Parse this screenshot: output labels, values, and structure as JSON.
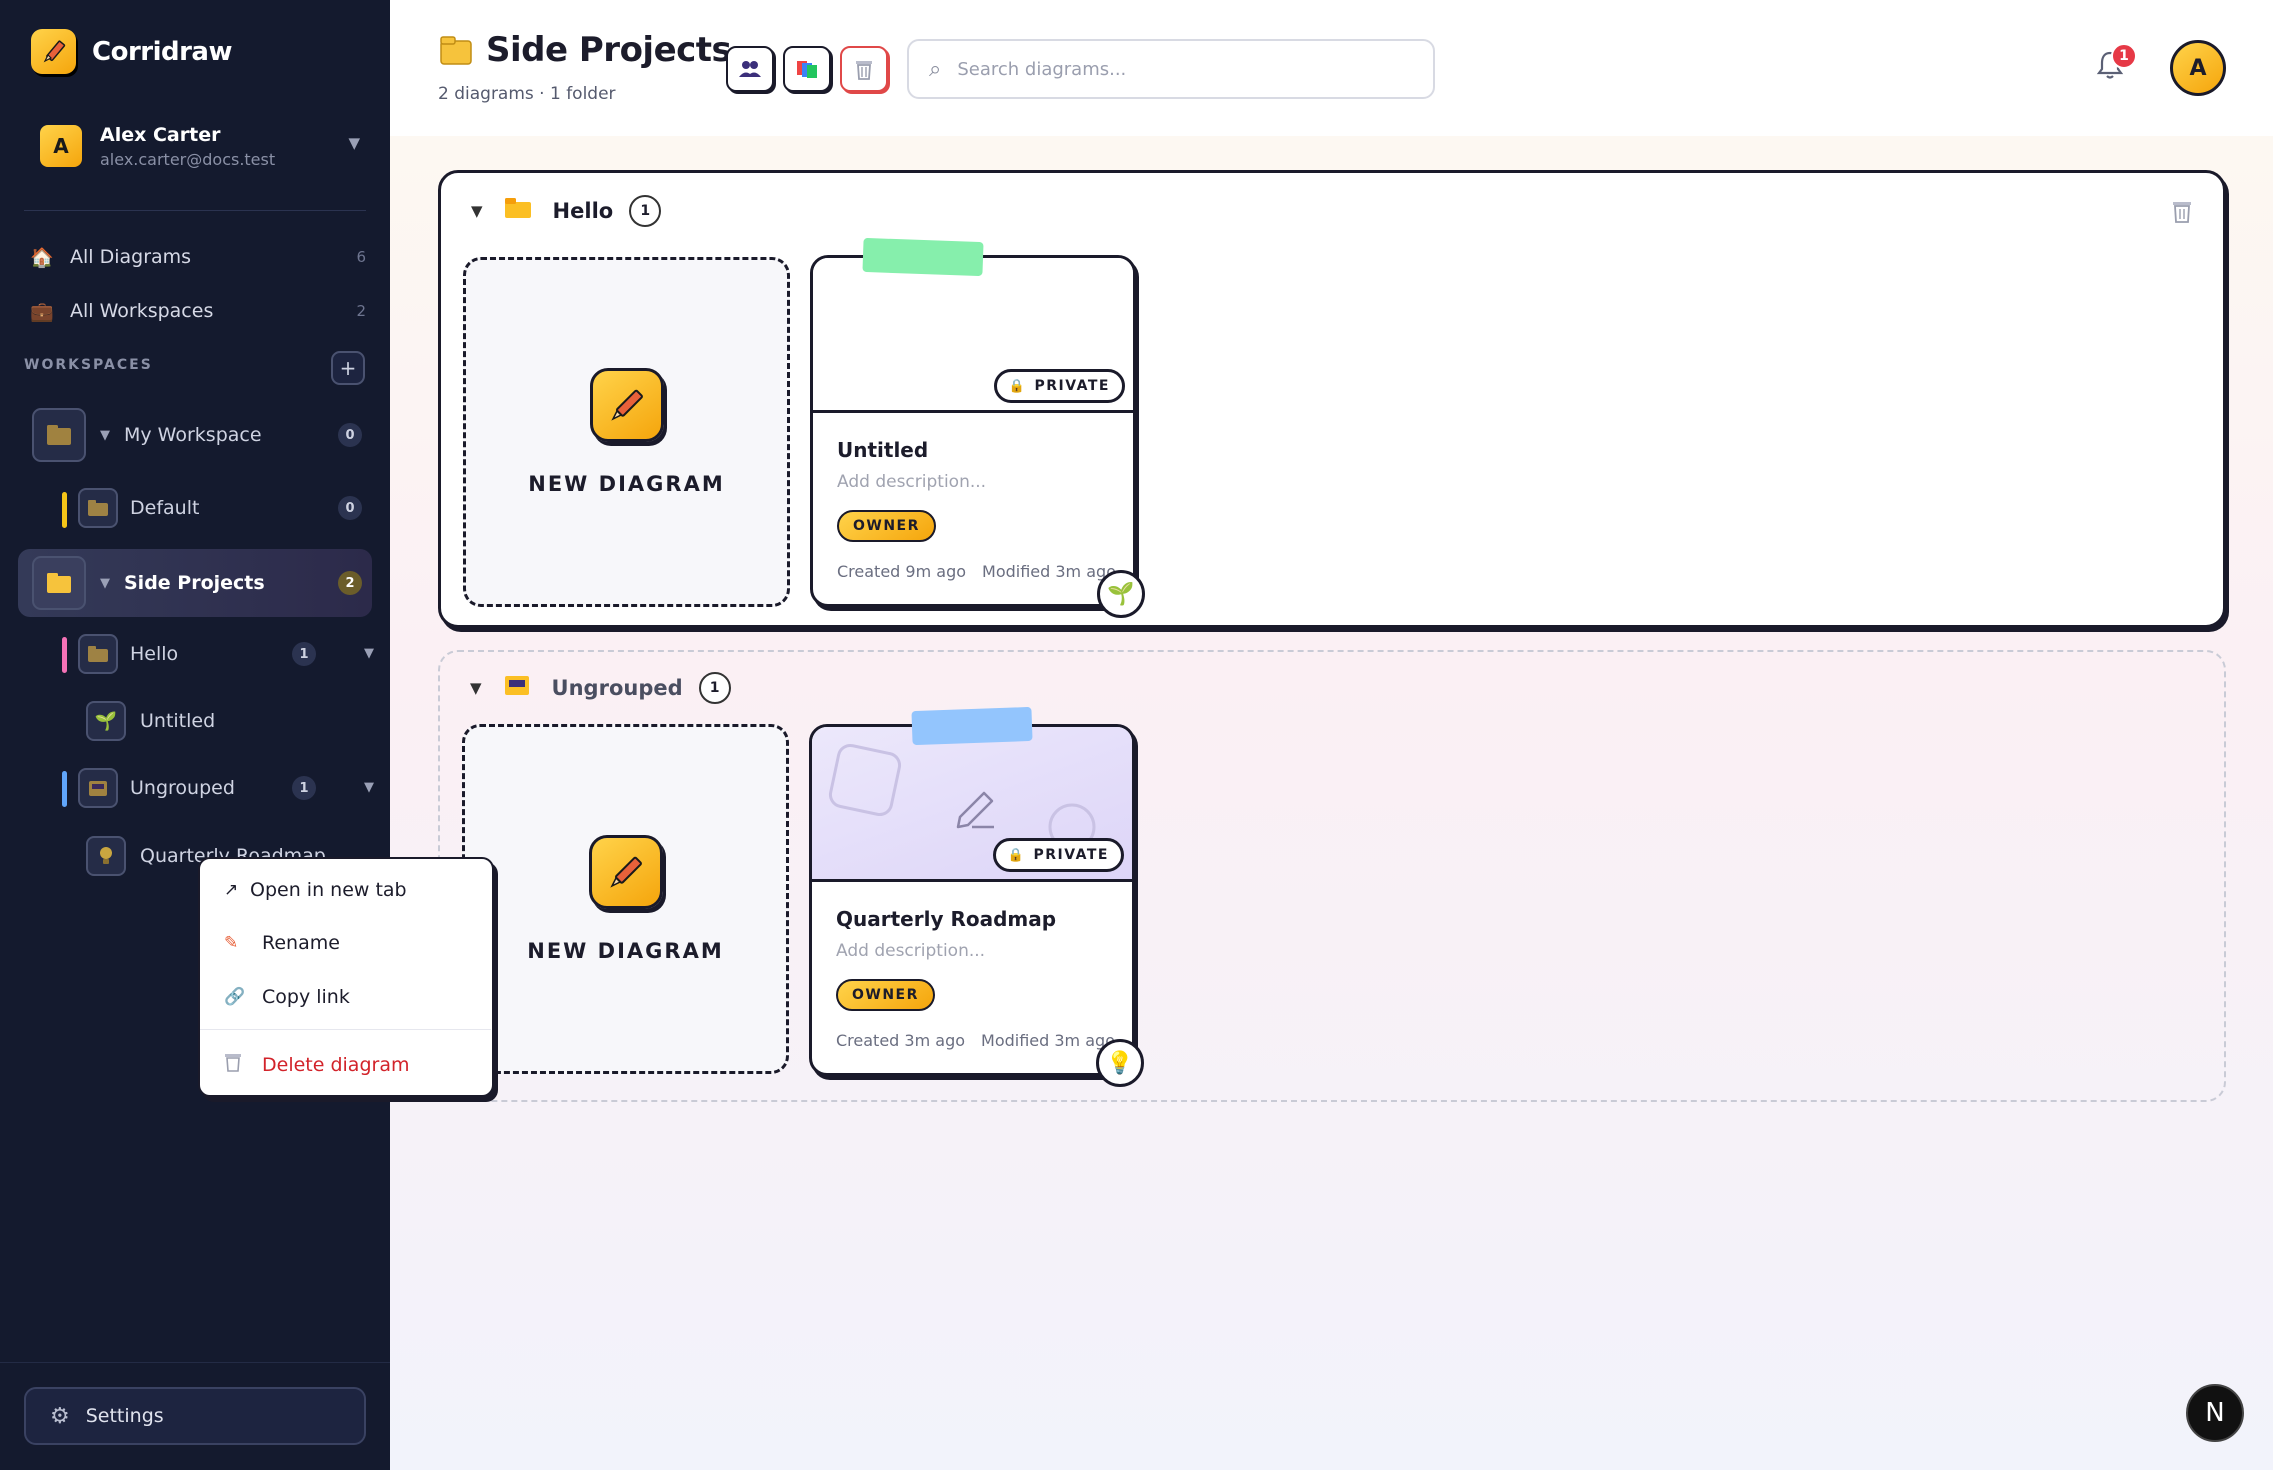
{
  "app": {
    "name": "Corridraw"
  },
  "user": {
    "initial": "A",
    "name": "Alex Carter",
    "email": "alex.carter@docs.test"
  },
  "nav": [
    {
      "icon": "house-icon",
      "glyph": "🏠",
      "label": "All Diagrams",
      "count": "6"
    },
    {
      "icon": "briefcase-icon",
      "glyph": "💼",
      "label": "All Workspaces",
      "count": "2"
    }
  ],
  "workspaces_heading": "WORKSPACES",
  "add_glyph": "+",
  "tree": {
    "my_workspace": {
      "label": "My Workspace",
      "count": "0"
    },
    "default": {
      "label": "Default",
      "count": "0",
      "bar": "#f5c518"
    },
    "side_projects": {
      "label": "Side Projects",
      "count": "2"
    },
    "hello": {
      "label": "Hello",
      "count": "1",
      "bar": "#f472b6"
    },
    "untitled": {
      "label": "Untitled"
    },
    "ungrouped": {
      "label": "Ungrouped",
      "count": "1",
      "bar": "#60a5fa"
    },
    "quarterly": {
      "label": "Quarterly Roadmap"
    }
  },
  "settings_label": "Settings",
  "header": {
    "title": "Side Projects",
    "subtitle": "2 diagrams · 1 folder",
    "search_placeholder": "Search diagrams...",
    "notification_count": "1",
    "avatar_initial": "A"
  },
  "folders": {
    "hello": {
      "name": "Hello",
      "count": "1"
    },
    "ungrouped": {
      "name": "Ungrouped",
      "count": "1"
    }
  },
  "new_diagram_label": "NEW DIAGRAM",
  "cards": {
    "untitled": {
      "title": "Untitled",
      "description": "Add description...",
      "visibility": "PRIVATE",
      "role": "OWNER",
      "created": "Created 9m ago",
      "modified": "Modified 3m ago",
      "emoji": "🌱",
      "tape": "#86efac"
    },
    "quarterly": {
      "title": "Quarterly Roadmap",
      "description": "Add description...",
      "visibility": "PRIVATE",
      "role": "OWNER",
      "created": "Created 3m ago",
      "modified": "Modified 3m ago",
      "emoji": "💡",
      "tape": "#93c5fd"
    }
  },
  "context_menu": {
    "open": "Open in new tab",
    "rename": "Rename",
    "copy": "Copy link",
    "delete": "Delete diagram"
  },
  "colors": {
    "accent": "#f5a50c",
    "sidebar_bg": "#141a2e",
    "danger": "#d2232a"
  },
  "next_badge": "N"
}
